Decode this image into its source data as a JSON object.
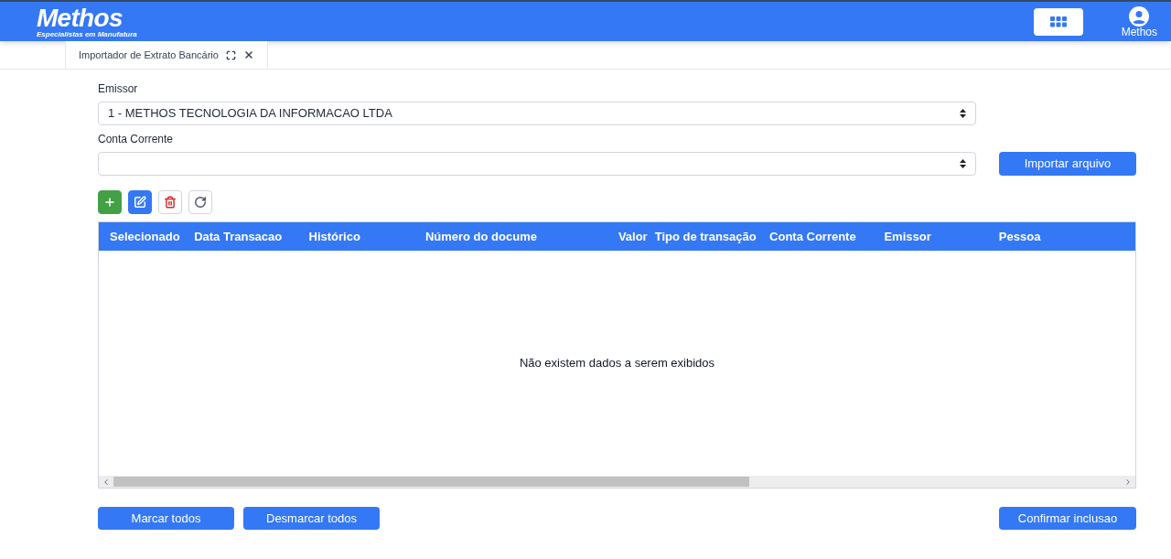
{
  "header": {
    "logo": "Methos",
    "tagline": "Especialistas em Manufatura",
    "user": "Methos"
  },
  "tabs": [
    {
      "label": "Importador de Extrato Bancário",
      "selected": true
    }
  ],
  "form": {
    "emissor": {
      "label": "Emissor",
      "value": "1 - METHOS TECNOLOGIA DA INFORMACAO LTDA"
    },
    "conta": {
      "label": "Conta Corrente"
    },
    "import_button": "Importar arquivo"
  },
  "toolbar": [
    {
      "kind": "add"
    },
    {
      "kind": "edit"
    },
    {
      "kind": "delete"
    },
    {
      "kind": "refresh"
    }
  ],
  "table": {
    "columns": [
      "Selecionado",
      "Data Transacao",
      "Histórico",
      "Número do docume",
      "Valor",
      "Tipo de transação",
      "Conta Corrente",
      "Emissor",
      "Pessoa"
    ],
    "empty_message": "Não existem dados a serem exibidos"
  },
  "footer": {
    "left_buttons": [
      "Marcar todos",
      "Desmarcar todos"
    ],
    "right_button": "Confirmar inclusao"
  }
}
